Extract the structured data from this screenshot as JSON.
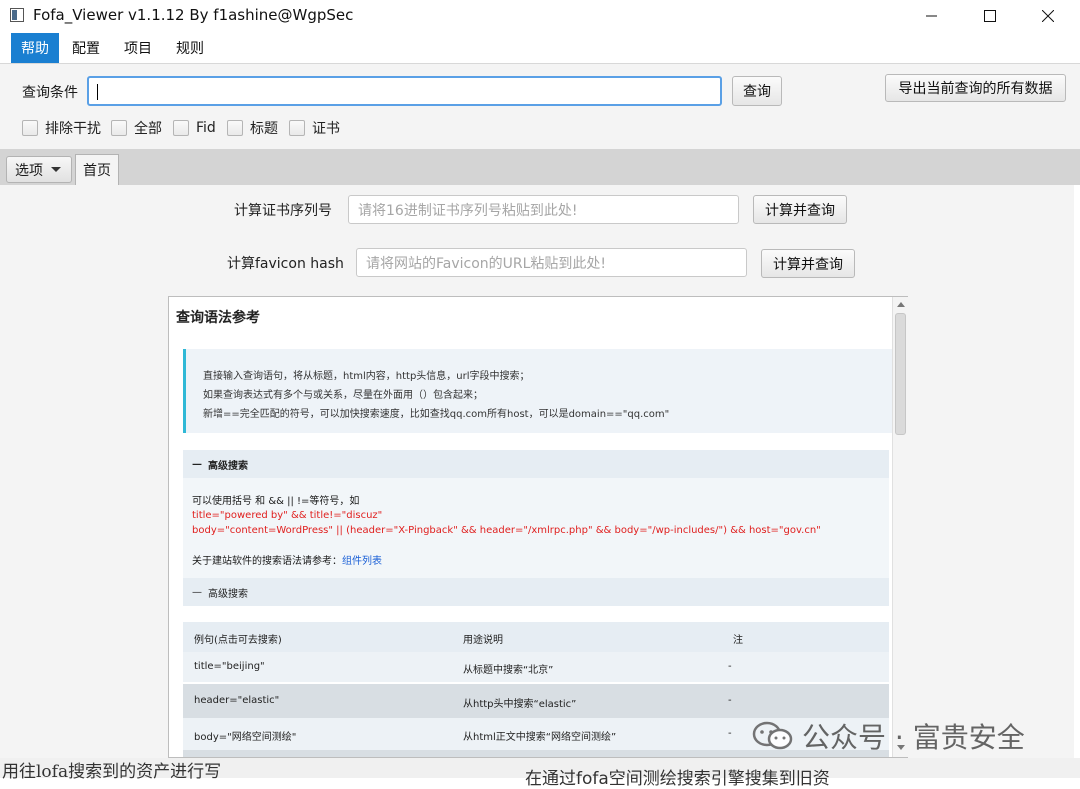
{
  "window": {
    "title": "Fofa_Viewer v1.1.12 By f1ashine@WgpSec"
  },
  "menu": {
    "items": [
      "帮助",
      "配置",
      "项目",
      "规则"
    ]
  },
  "query": {
    "label": "查询条件",
    "input_value": "",
    "search_button": "查询",
    "export_button": "导出当前查询的所有数据",
    "checkboxes": [
      "排除干扰",
      "全部",
      "Fid",
      "标题",
      "证书"
    ]
  },
  "tabs": {
    "options_label": "选项",
    "home_label": "首页"
  },
  "cert": {
    "label": "计算证书序列号",
    "placeholder": "请将16进制证书序列号粘贴到此处!",
    "button": "计算并查询"
  },
  "favicon": {
    "label": "计算favicon hash",
    "placeholder": "请将网站的Favicon的URL粘贴到此处!",
    "button": "计算并查询"
  },
  "reference": {
    "title": "查询语法参考",
    "info_lines": [
      "直接输入查询语句，将从标题，html内容，http头信息，url字段中搜索；",
      "如果查询表达式有多个与或关系，尽量在外面用（）包含起来；",
      "新增==完全匹配的符号，可以加快搜索速度，比如查找qq.com所有host，可以是domain==\"qq.com\""
    ],
    "section1_title": "高级搜索",
    "section1_intro": "可以使用括号 和 && || !=等符号，如",
    "section1_examples": [
      "title=\"powered by\" && title!=\"discuz\"",
      "body=\"content=WordPress\" || (header=\"X-Pingback\" && header=\"/xmlrpc.php\" && body=\"/wp-includes/\") && host=\"gov.cn\""
    ],
    "section1_ref_prefix": "关于建站软件的搜索语法请参考：",
    "section1_ref_link": "组件列表",
    "section2_title": "高级搜索",
    "table_headers": [
      "例句(点击可去搜索)",
      "用途说明",
      "注"
    ],
    "table_rows": [
      [
        "title=\"beijing\"",
        "从标题中搜索“北京”",
        "-"
      ],
      [
        "header=\"elastic\"",
        "从http头中搜索“elastic”",
        "-"
      ],
      [
        "body=\"网络空间测绘\"",
        "从html正文中搜索“网络空间测绘”",
        "-"
      ]
    ]
  },
  "background": {
    "left_text": "用往lofa搜索到的资产进行写",
    "right_text": "在通过fofa空间测绘搜索引擎搜集到旧资",
    "watermark": "公众号 · 富贵安全"
  }
}
